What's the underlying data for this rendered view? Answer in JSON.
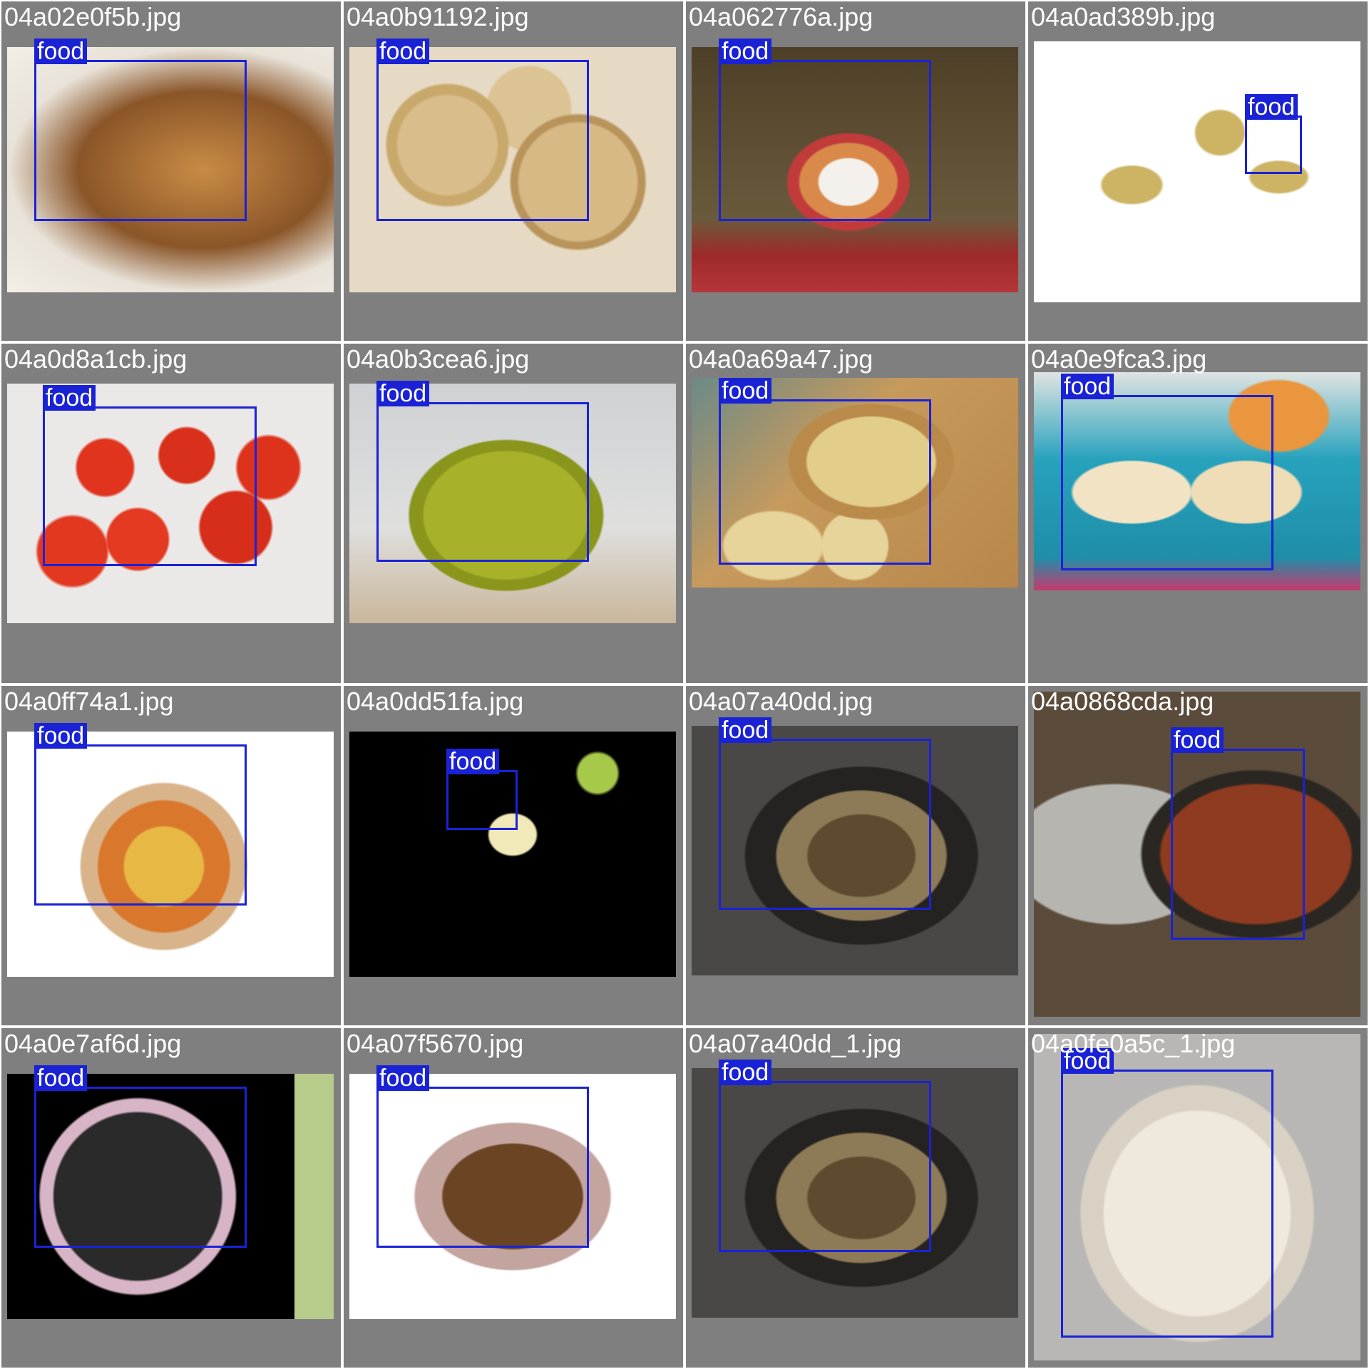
{
  "tiles": [
    {
      "file": "04a02e0f5b.jpg",
      "label": "food",
      "image": "coffee-cake"
    },
    {
      "file": "04a0b91192.jpg",
      "label": "food",
      "image": "cookies"
    },
    {
      "file": "04a062776a.jpg",
      "label": "food",
      "image": "fruit-parfait"
    },
    {
      "file": "04a0ad389b.jpg",
      "label": "food",
      "image": "bunny-toppers"
    },
    {
      "file": "04a0d8a1cb.jpg",
      "label": "food",
      "image": "tomatoes"
    },
    {
      "file": "04a0b3cea6.jpg",
      "label": "food",
      "image": "jar-of-juice"
    },
    {
      "file": "04a0a69a47.jpg",
      "label": "food",
      "image": "bread-loaf"
    },
    {
      "file": "04a0e9fca3.jpg",
      "label": "food",
      "image": "breakfast-pastry"
    },
    {
      "file": "04a0ff74a1.jpg",
      "label": "food",
      "image": "fruit-tart"
    },
    {
      "file": "04a0dd51fa.jpg",
      "label": "food",
      "image": "martini"
    },
    {
      "file": "04a07a40dd.jpg",
      "label": "food",
      "image": "pot-roast"
    },
    {
      "file": "04a0868cda.jpg",
      "label": "food",
      "image": "dutch-oven-beans"
    },
    {
      "file": "04a0e7af6d.jpg",
      "label": "food",
      "image": "quail-eggs"
    },
    {
      "file": "04a07f5670.jpg",
      "label": "food",
      "image": "seasoned-meat"
    },
    {
      "file": "04a07a40dd_1.jpg",
      "label": "food",
      "image": "pot-roast"
    },
    {
      "file": "04a0fe0a5c_1.jpg",
      "label": "food",
      "image": "creamy-soup"
    }
  ],
  "colors": {
    "box": "#1a22d6",
    "tile_bg": "#7f7f7f",
    "grid_line": "#ffffff"
  }
}
